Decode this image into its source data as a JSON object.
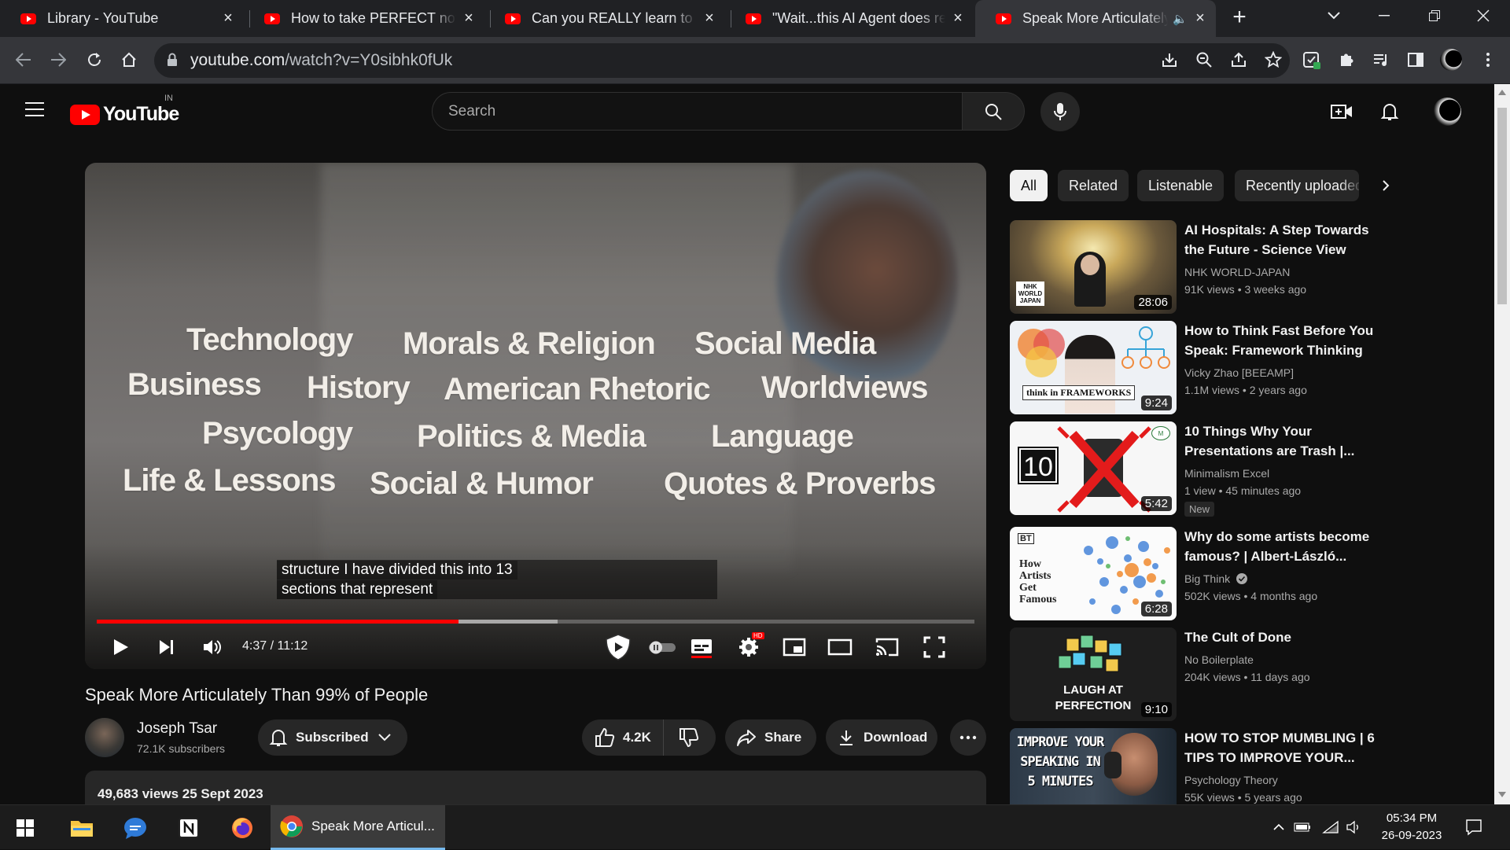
{
  "browser": {
    "tabs": [
      {
        "title": "Library - YouTube"
      },
      {
        "title": "How to take PERFECT notes w"
      },
      {
        "title": "Can you REALLY learn to code"
      },
      {
        "title": "\"Wait...this AI Agent does rese"
      },
      {
        "title": "Speak More Articulately T"
      }
    ],
    "new_tab": "+",
    "url_domain": "youtube.com",
    "url_path": "/watch?v=Y0sibhk0fUk"
  },
  "header": {
    "logo_text": "YouTube",
    "country_code": "IN",
    "search_placeholder": "Search"
  },
  "player": {
    "topics": [
      "Technology",
      "Morals & Religion",
      "Social Media",
      "Business",
      "History",
      "American Rhetoric",
      "Worldviews",
      "Psycology",
      "Politics & Media",
      "Language",
      "Life & Lessons",
      "Social & Humor",
      "Quotes & Proverbs"
    ],
    "caption_line1": "structure I have divided this into 13",
    "caption_line2": "sections that represent",
    "time_display": "4:37 / 11:12",
    "played_fraction": 0.412,
    "buffered_fraction": 0.525,
    "settings_badge": "HD"
  },
  "video": {
    "title": "Speak More Articulately Than 99% of People",
    "channel": "Joseph Tsar",
    "subscribers": "72.1K subscribers",
    "subscribe_label": "Subscribed",
    "likes": "4.2K",
    "share_label": "Share",
    "download_label": "Download",
    "views_date": "49,683 views  25 Sept 2023"
  },
  "sidebar": {
    "chips": [
      "All",
      "Related",
      "Listenable",
      "Recently uploaded"
    ],
    "recommendations": [
      {
        "title": "AI Hospitals: A Step Towards the Future - Science View",
        "channel": "NHK WORLD-JAPAN",
        "meta": "91K views  • 3 weeks ago",
        "duration": "28:06",
        "thumb_text": "NHK WORLD JAPAN"
      },
      {
        "title": "How to Think Fast Before You Speak: Framework Thinking",
        "channel": "Vicky Zhao [BEEAMP]",
        "meta": "1.1M views  • 2 years ago",
        "duration": "9:24",
        "thumb_text": "think in FRAMEWORKS"
      },
      {
        "title": "10 Things Why Your Presentations are Trash |...",
        "channel": "Minimalism Excel",
        "meta": "1 view  • 45 minutes ago",
        "duration": "5:42",
        "badge": "New",
        "thumb_text": "10"
      },
      {
        "title": "Why do some artists become famous? | Albert-László...",
        "channel": "Big Think",
        "meta": "502K views  • 4 months ago",
        "duration": "6:28",
        "thumb_text": "How Artists Get Famous",
        "thumb_logo": "BT"
      },
      {
        "title": "The Cult of Done",
        "channel": "No Boilerplate",
        "meta": "204K views  • 11 days ago",
        "duration": "9:10",
        "thumb_text": "LAUGH AT PERFECTION"
      },
      {
        "title": "HOW TO STOP MUMBLING | 6 TIPS TO IMPROVE YOUR...",
        "channel": "Psychology Theory",
        "meta": "55K views  • 5 years ago",
        "duration": "",
        "thumb_text": "IMPROVE YOUR SPEAKING IN 5 MINUTES"
      }
    ]
  },
  "taskbar": {
    "active_app_label": "Speak More Articul...",
    "time": "05:34 PM",
    "date": "26-09-2023"
  },
  "colors": {
    "youtube_red": "#ff0000",
    "background": "#0f0f0f",
    "chip_bg": "#272727"
  }
}
